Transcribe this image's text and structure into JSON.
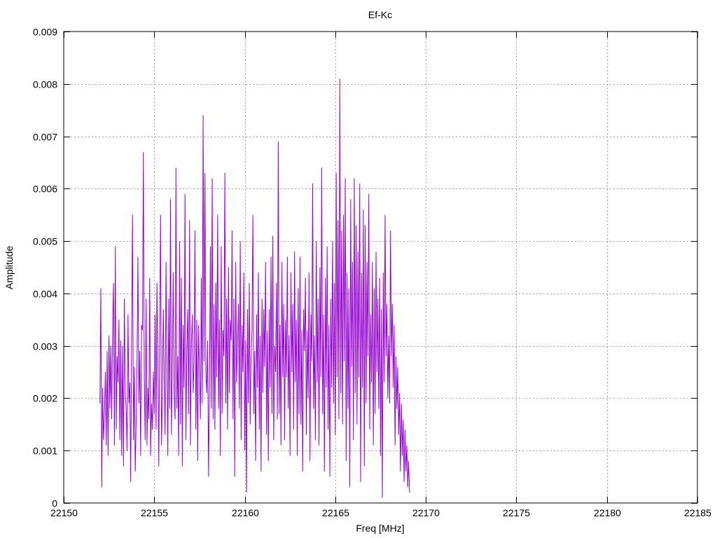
{
  "chart_data": {
    "type": "line",
    "title": "Ef-Kc",
    "xlabel": "Freq [MHz]",
    "ylabel": "Amplitude",
    "xlim": [
      22150,
      22185
    ],
    "ylim": [
      0,
      0.009
    ],
    "grid": true,
    "legend": "none",
    "x_ticks": [
      22150,
      22155,
      22160,
      22165,
      22170,
      22175,
      22180,
      22185
    ],
    "y_ticks": [
      0,
      0.001,
      0.002,
      0.003,
      0.004,
      0.005,
      0.006,
      0.007,
      0.008,
      0.009
    ],
    "x_tick_labels": [
      "22150",
      "22155",
      "22160",
      "22165",
      "22170",
      "22175",
      "22180",
      "22185"
    ],
    "y_tick_labels": [
      "0",
      "0.001",
      "0.002",
      "0.003",
      "0.004",
      "0.005",
      "0.006",
      "0.007",
      "0.008",
      "0.009"
    ],
    "series_color": "#9400d3",
    "series": [
      {
        "x_start": 22152.0,
        "x_step": 0.05,
        "values": [
          0.0019,
          0.0041,
          0.0003,
          0.0022,
          0.0012,
          0.0017,
          0.0025,
          0.0011,
          0.0029,
          0.0009,
          0.0032,
          0.0018,
          0.003,
          0.0016,
          0.0033,
          0.0042,
          0.0011,
          0.0049,
          0.0014,
          0.0028,
          0.0023,
          0.0035,
          0.0012,
          0.0031,
          0.0009,
          0.003,
          0.0007,
          0.0039,
          0.0021,
          0.0018,
          0.001,
          0.0036,
          0.0019,
          0.0023,
          0.0004,
          0.0031,
          0.0055,
          0.0012,
          0.0026,
          0.0006,
          0.0015,
          0.0027,
          0.0047,
          0.0019,
          0.0029,
          0.0009,
          0.0034,
          0.0033,
          0.0067,
          0.0024,
          0.0012,
          0.0039,
          0.0011,
          0.0022,
          0.0016,
          0.0043,
          0.0009,
          0.0019,
          0.0014,
          0.0025,
          0.0017,
          0.0036,
          0.0014,
          0.0042,
          0.0028,
          0.0007,
          0.0031,
          0.0055,
          0.0011,
          0.002,
          0.0037,
          0.0024,
          0.0013,
          0.0046,
          0.0028,
          0.0009,
          0.0039,
          0.0018,
          0.0058,
          0.0013,
          0.0026,
          0.0044,
          0.0021,
          0.0016,
          0.0064,
          0.0018,
          0.0028,
          0.0009,
          0.005,
          0.0015,
          0.0043,
          0.0007,
          0.0034,
          0.0022,
          0.0059,
          0.0012,
          0.0029,
          0.0037,
          0.0017,
          0.0054,
          0.0011,
          0.003,
          0.0036,
          0.0021,
          0.0027,
          0.0052,
          0.0014,
          0.0035,
          0.0008,
          0.0034,
          0.0025,
          0.0016,
          0.0043,
          0.0019,
          0.0074,
          0.0027,
          0.0063,
          0.0025,
          0.0021,
          0.0031,
          0.0005,
          0.0022,
          0.0049,
          0.0018,
          0.0062,
          0.0016,
          0.0038,
          0.0014,
          0.0042,
          0.0024,
          0.0055,
          0.0018,
          0.0035,
          0.0009,
          0.0049,
          0.0017,
          0.0033,
          0.0028,
          0.0063,
          0.0019,
          0.0039,
          0.0014,
          0.0045,
          0.0021,
          0.0035,
          0.0031,
          0.0052,
          0.0016,
          0.0039,
          0.0005,
          0.0046,
          0.0023,
          0.003,
          0.0038,
          0.0018,
          0.005,
          0.0012,
          0.0034,
          0.0025,
          0.0044,
          0.001,
          0.0031,
          0.0002,
          0.0037,
          0.0019,
          0.0042,
          0.0015,
          0.0028,
          0.0033,
          0.0055,
          0.0017,
          0.0029,
          0.0008,
          0.0036,
          0.0022,
          0.0044,
          0.0014,
          0.0032,
          0.0006,
          0.0039,
          0.0021,
          0.0037,
          0.0026,
          0.0046,
          0.0013,
          0.0033,
          0.0008,
          0.0037,
          0.0022,
          0.0047,
          0.0017,
          0.0051,
          0.0012,
          0.003,
          0.0025,
          0.0042,
          0.0016,
          0.0069,
          0.0017,
          0.0034,
          0.0011,
          0.0046,
          0.0024,
          0.0038,
          0.0012,
          0.0035,
          0.0024,
          0.0047,
          0.0018,
          0.0032,
          0.0009,
          0.0044,
          0.0025,
          0.0038,
          0.0014,
          0.0048,
          0.0023,
          0.0035,
          0.0009,
          0.0041,
          0.0017,
          0.0047,
          0.0015,
          0.0033,
          0.0006,
          0.0037,
          0.0029,
          0.0043,
          0.0013,
          0.0033,
          0.002,
          0.0044,
          0.0008,
          0.0036,
          0.0027,
          0.0061,
          0.0018,
          0.0032,
          0.0012,
          0.005,
          0.0023,
          0.0039,
          0.0011,
          0.0045,
          0.0024,
          0.0064,
          0.0017,
          0.0036,
          0.0006,
          0.0043,
          0.0022,
          0.0049,
          0.0014,
          0.0034,
          0.0005,
          0.0039,
          0.0022,
          0.005,
          0.0019,
          0.0042,
          0.0013,
          0.0063,
          0.0024,
          0.0054,
          0.0016,
          0.0081,
          0.0021,
          0.0052,
          0.0015,
          0.0055,
          0.0027,
          0.0062,
          0.0008,
          0.0044,
          0.0018,
          0.0041,
          0.0003,
          0.0058,
          0.0026,
          0.0046,
          0.0012,
          0.0062,
          0.0021,
          0.0053,
          0.0015,
          0.0048,
          0.0024,
          0.0061,
          0.0004,
          0.0044,
          0.0022,
          0.0056,
          0.0007,
          0.0053,
          0.0019,
          0.0046,
          0.0028,
          0.0059,
          0.0014,
          0.0036,
          0.0023,
          0.0046,
          0.0011,
          0.0041,
          0.0017,
          0.0048,
          0.0025,
          0.0039,
          0.0018,
          0.0043,
          0.0009,
          0.0037,
          0.0001,
          0.0044,
          0.0023,
          0.0055,
          0.0028,
          0.0038,
          0.002,
          0.0032,
          0.0019,
          0.0052,
          0.0028,
          0.0038,
          0.0022,
          0.0034,
          0.0011,
          0.0028,
          0.0018,
          0.0026,
          0.0013,
          0.0021,
          0.0006,
          0.0019,
          0.0009,
          0.0016,
          0.0004,
          0.0014,
          0.0006,
          0.0011,
          0.0003,
          0.0008,
          0.0002
        ]
      }
    ]
  }
}
